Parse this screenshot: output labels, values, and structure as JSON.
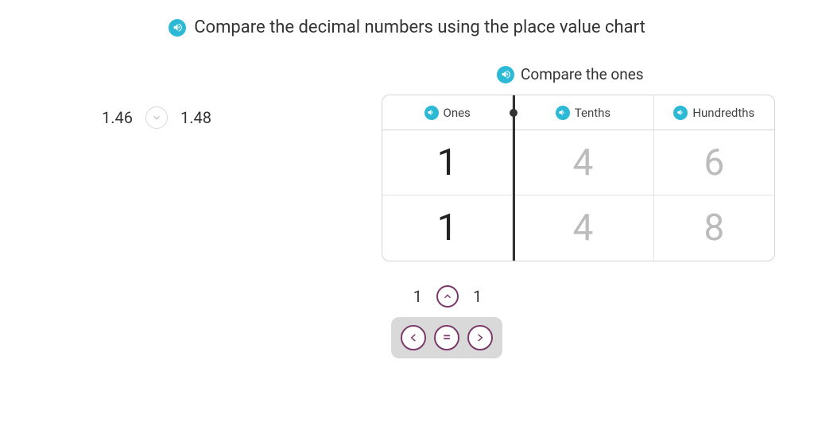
{
  "title": "Compare the decimal numbers using the place value chart",
  "left": {
    "a": "1.46",
    "b": "1.48"
  },
  "step_label": "Compare the ones",
  "chart": {
    "headers": {
      "ones": "Ones",
      "tenths": "Tenths",
      "hundredths": "Hundredths"
    },
    "rows": [
      {
        "ones": "1",
        "tenths": "4",
        "hundredths": "6"
      },
      {
        "ones": "1",
        "tenths": "4",
        "hundredths": "8"
      }
    ]
  },
  "answer": {
    "a": "1",
    "b": "1"
  },
  "operators": {
    "lt": "<",
    "eq": "=",
    "gt": ">"
  },
  "colors": {
    "accent_audio": "#2cb9d6",
    "accent_op": "#7b3b6a"
  }
}
